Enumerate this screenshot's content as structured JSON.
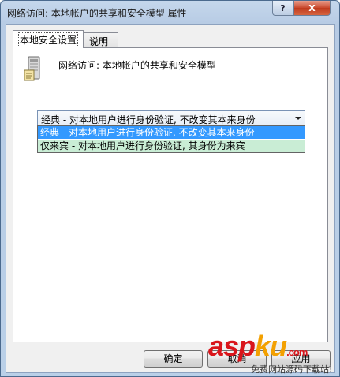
{
  "window": {
    "title": "网络访问: 本地帐户的共享和安全模型 属性",
    "help_button": "?",
    "close_button": "X"
  },
  "tabs": [
    {
      "label": "本地安全设置",
      "active": true
    },
    {
      "label": "说明",
      "active": false
    }
  ],
  "policy": {
    "icon": "server-icon",
    "title": "网络访问: 本地帐户的共享和安全模型"
  },
  "combo": {
    "selected": "经典 - 对本地用户进行身份验证, 不改变其本来身份",
    "options": [
      "经典 - 对本地用户进行身份验证, 不改变其本来身份",
      "仅来宾 - 对本地用户进行身份验证, 其身份为来宾"
    ]
  },
  "buttons": {
    "ok": "确定",
    "cancel": "取消",
    "apply": "应用"
  },
  "watermark": {
    "brand_a": "asp",
    "brand_k": "ku",
    "brand_tail": ".com",
    "subtitle": "免费网站源码下载站!"
  },
  "colors": {
    "selection": "#3399ff",
    "alt_option": "#c9edd5",
    "close_button": "#c9482c",
    "watermark": "#d9151b"
  }
}
